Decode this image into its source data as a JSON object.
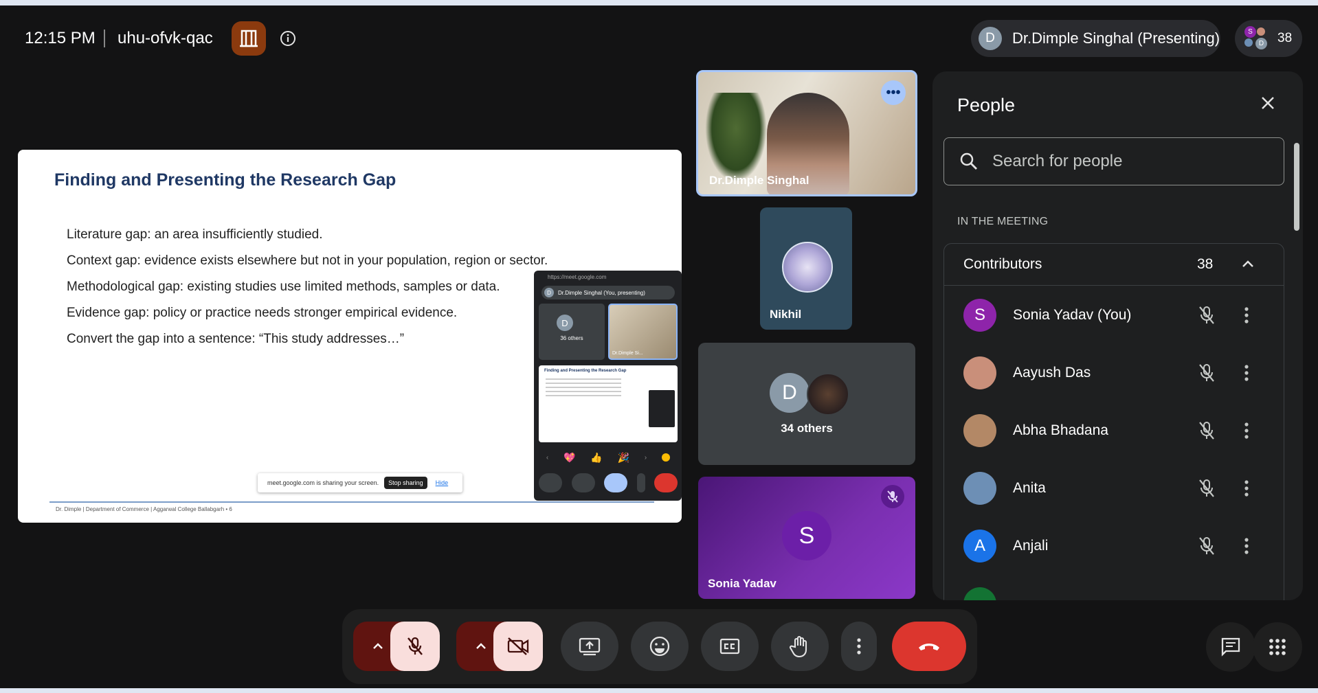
{
  "header": {
    "time": "12:15 PM",
    "meeting_code": "uhu-ofvk-qac",
    "room_icon": "door-icon",
    "info_icon": "info-icon",
    "presenter_initial": "D",
    "presenter_label": "Dr.Dimple Singhal (Presenting)",
    "participant_count": "38",
    "count_avatar_initials": [
      "S",
      "D"
    ]
  },
  "slide": {
    "title": "Finding and Presenting the Research Gap",
    "lines": [
      "Literature gap: an area insufficiently studied.",
      "Context gap: evidence exists elsewhere but not in your population, region or sector.",
      "Methodological gap: existing studies use limited methods, samples or data.",
      "Evidence gap: policy or practice needs stronger empirical evidence.",
      "Convert the gap into a sentence: “This study addresses…”"
    ],
    "footer": "Dr. Dimple | Department of Commerce | Aggarwal College Ballabgarh   •   6",
    "share_bar": {
      "message": "meet.google.com is sharing your screen.",
      "stop_label": "Stop sharing",
      "hide_label": "Hide"
    },
    "pip": {
      "url": "https://meet.google.com",
      "presenting_label": "Dr.Dimple Singhal (You, presenting)",
      "presenter_initial": "D",
      "others_label": "36 others",
      "cam_label": "Dr.Dimple Si...",
      "mini_slide_title": "Finding and Presenting the Research Gap",
      "reactions": [
        "💖",
        "👍",
        "🎉"
      ]
    }
  },
  "tiles": {
    "presenter": {
      "name": "Dr.Dimple Singhal",
      "more_label": "•••"
    },
    "nikhil": {
      "name": "Nikhil"
    },
    "others": {
      "initial": "D",
      "label": "34 others"
    },
    "sonia": {
      "initial": "S",
      "name": "Sonia Yadav"
    }
  },
  "people_panel": {
    "title": "People",
    "search_placeholder": "Search for people",
    "section_label": "IN THE MEETING",
    "group_label": "Contributors",
    "group_count": "38",
    "participants": [
      {
        "name": "Sonia Yadav (You)",
        "initial": "S",
        "color": "#8e24aa"
      },
      {
        "name": "Aayush Das",
        "initial": "",
        "color": "#c98f7a"
      },
      {
        "name": "Abha Bhadana",
        "initial": "",
        "color": "#b38866"
      },
      {
        "name": "Anita",
        "initial": "",
        "color": "#6d8fb5"
      },
      {
        "name": "Anjali",
        "initial": "A",
        "color": "#1a73e8"
      }
    ]
  },
  "controls": {
    "mic_state": "muted",
    "camera_state": "off",
    "icons": [
      "chevron-up-icon",
      "mic-off-icon",
      "chevron-up-icon",
      "camera-off-icon",
      "present-icon",
      "emoji-icon",
      "captions-icon",
      "hand-icon",
      "more-icon",
      "end-call-icon",
      "chat-icon",
      "apps-icon"
    ],
    "colors": {
      "muted_bg": "#f9dedc",
      "split_bg": "#601410",
      "end_call": "#dc362e"
    }
  }
}
